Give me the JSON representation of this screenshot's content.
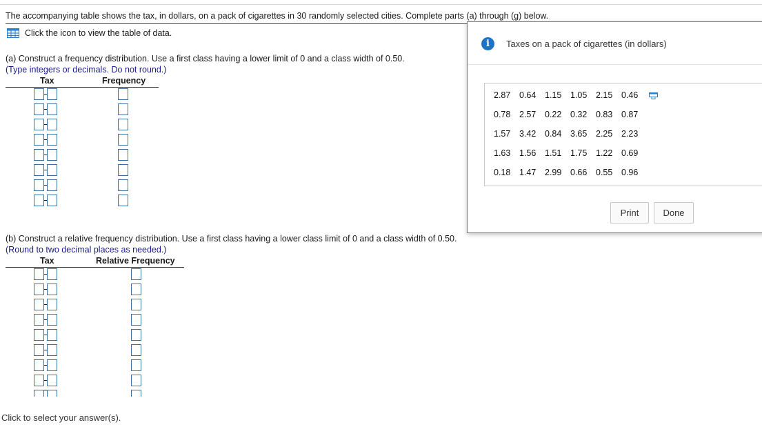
{
  "question": {
    "intro": "The accompanying table shows the tax, in dollars, on a pack of cigarettes in 30 randomly selected cities. Complete parts (a) through (g) below.",
    "table_link": "Click the icon to view the table of data."
  },
  "part_a": {
    "title": "(a) Construct a frequency distribution. Use a first class having a lower limit of 0 and a class width of 0.50.",
    "hint": "(Type integers or decimals. Do not round.)",
    "col_tax": "Tax",
    "col_freq": "Frequency"
  },
  "part_b": {
    "title": "(b) Construct a relative frequency distribution. Use a first class having a lower class limit of 0 and a class width of 0.50.",
    "hint": "(Round to two decimal places as needed.)",
    "col_tax": "Tax",
    "col_freq": "Relative Frequency"
  },
  "footer": "Click to select your answer(s).",
  "popup": {
    "title": "Taxes on a pack of cigarettes (in dollars)",
    "rows": [
      [
        "2.87",
        "0.64",
        "1.15",
        "1.05",
        "2.15",
        "0.46"
      ],
      [
        "0.78",
        "2.57",
        "0.22",
        "0.32",
        "0.83",
        "0.87"
      ],
      [
        "1.57",
        "3.42",
        "0.84",
        "3.65",
        "2.25",
        "2.23"
      ],
      [
        "1.63",
        "1.56",
        "1.51",
        "1.75",
        "1.22",
        "0.69"
      ],
      [
        "0.18",
        "1.47",
        "2.99",
        "0.66",
        "0.55",
        "0.96"
      ]
    ],
    "print_label": "Print",
    "done_label": "Done"
  },
  "colors": {
    "input_border": "#3e6f9e",
    "hint_text": "#1a1a8c",
    "info_icon": "#1f72c8"
  }
}
